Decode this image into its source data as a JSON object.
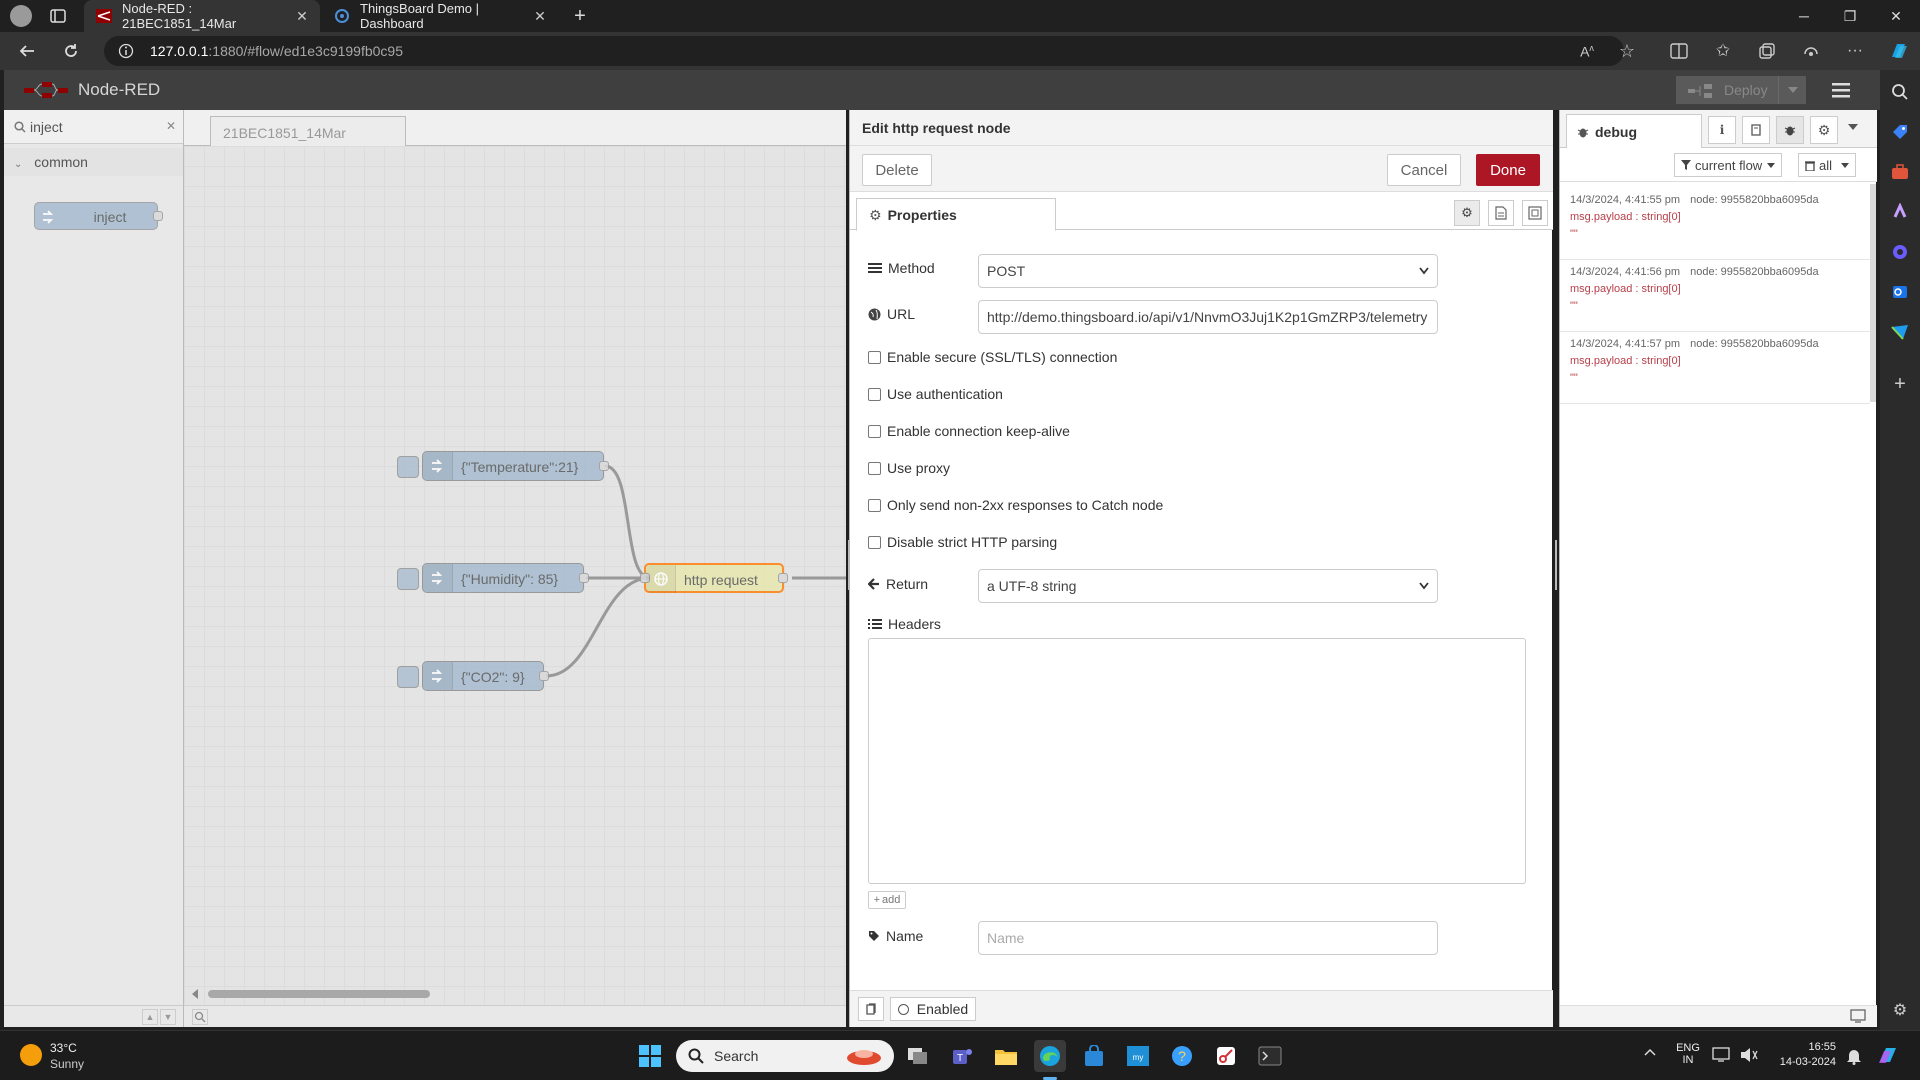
{
  "browser": {
    "tabs": [
      {
        "title": "Node-RED : 21BEC1851_14Mar",
        "active": true
      },
      {
        "title": "ThingsBoard Demo | Dashboard",
        "active": false
      }
    ],
    "url_host": "127.0.0.1",
    "url_rest": ":1880/#flow/ed1e3c9199fb0c95"
  },
  "nodered": {
    "title": "Node-RED",
    "deploy_label": "Deploy",
    "palette": {
      "search_value": "inject",
      "category": "common",
      "node_label": "inject"
    },
    "workspace": {
      "tab_label": "21BEC1851_14Mar",
      "nodes": [
        {
          "label": "{\"Temperature\":21}"
        },
        {
          "label": "{\"Humidity\": 85}"
        },
        {
          "label": "{\"CO2\": 9}"
        },
        {
          "label": "http request"
        }
      ]
    }
  },
  "tray": {
    "title": "Edit http request node",
    "delete_label": "Delete",
    "cancel_label": "Cancel",
    "done_label": "Done",
    "properties_tab": "Properties",
    "method_label": "Method",
    "method_value": "POST",
    "url_label": "URL",
    "url_value": "http://demo.thingsboard.io/api/v1/NnvmO3Juj1K2p1GmZRP3/telemetry",
    "checkboxes": [
      "Enable secure (SSL/TLS) connection",
      "Use authentication",
      "Enable connection keep-alive",
      "Use proxy",
      "Only send non-2xx responses to Catch node",
      "Disable strict HTTP parsing"
    ],
    "return_label": "Return",
    "return_value": "a UTF-8 string",
    "headers_label": "Headers",
    "add_label": "add",
    "name_label": "Name",
    "name_placeholder": "Name",
    "enabled_label": "Enabled"
  },
  "debug": {
    "tab_label": "debug",
    "filter_flow": "current flow",
    "filter_all": "all",
    "messages": [
      {
        "time": "14/3/2024, 4:41:55 pm",
        "node": "node: 9955820bba6095da",
        "path": "msg.payload : string[0]",
        "value": "\"\""
      },
      {
        "time": "14/3/2024, 4:41:56 pm",
        "node": "node: 9955820bba6095da",
        "path": "msg.payload : string[0]",
        "value": "\"\""
      },
      {
        "time": "14/3/2024, 4:41:57 pm",
        "node": "node: 9955820bba6095da",
        "path": "msg.payload : string[0]",
        "value": "\"\""
      }
    ]
  },
  "taskbar": {
    "weather_temp": "33°C",
    "weather_desc": "Sunny",
    "search_label": "Search",
    "lang_top": "ENG",
    "lang_bottom": "IN",
    "time": "16:55",
    "date": "14-03-2024"
  },
  "colors": {
    "done_button": "#ad1625",
    "node_blue": "#a6bbcf",
    "http_node": "#e7e7ae",
    "debug_text": "#b5404a"
  }
}
